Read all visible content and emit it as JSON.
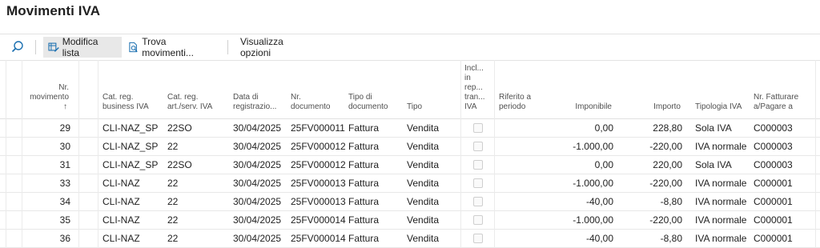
{
  "page": {
    "title": "Movimenti IVA"
  },
  "toolbar": {
    "search_icon": "search-icon",
    "edit_list_label": "Modifica lista",
    "find_entries_label": "Trova movimenti...",
    "view_options_label": "Visualizza opzioni"
  },
  "columns": {
    "nr_movimento": "Nr. movimento",
    "sort_indicator": "↑",
    "cat_business": "Cat. reg. business IVA",
    "cat_prodotto": "Cat. reg. art./serv. IVA",
    "data_reg": "Data di registrazio...",
    "nr_documento": "Nr. documento",
    "tipo_documento": "Tipo di documento",
    "tipo": "Tipo",
    "incl_trans": "Incl... in rep... tran... IVA",
    "riferito": "Riferito a periodo",
    "imponibile": "Imponibile",
    "importo": "Importo",
    "tipologia": "Tipologia IVA",
    "nr_fatturare": "Nr. Fatturare a/Pagare a"
  },
  "rows": [
    {
      "nr": "29",
      "cat_bus": "CLI-NAZ_SP",
      "cat_prod": "22SO",
      "data": "30/04/2025",
      "doc": "25FV000011",
      "tipo_doc": "Fattura",
      "tipo": "Vendita",
      "imponibile": "0,00",
      "importo": "228,80",
      "tipologia": "Sola IVA",
      "nr_fatt": "C000003"
    },
    {
      "nr": "30",
      "cat_bus": "CLI-NAZ_SP",
      "cat_prod": "22",
      "data": "30/04/2025",
      "doc": "25FV000012",
      "tipo_doc": "Fattura",
      "tipo": "Vendita",
      "imponibile": "-1.000,00",
      "importo": "-220,00",
      "tipologia": "IVA normale",
      "nr_fatt": "C000003"
    },
    {
      "nr": "31",
      "cat_bus": "CLI-NAZ_SP",
      "cat_prod": "22SO",
      "data": "30/04/2025",
      "doc": "25FV000012",
      "tipo_doc": "Fattura",
      "tipo": "Vendita",
      "imponibile": "0,00",
      "importo": "220,00",
      "tipologia": "Sola IVA",
      "nr_fatt": "C000003"
    },
    {
      "nr": "33",
      "cat_bus": "CLI-NAZ",
      "cat_prod": "22",
      "data": "30/04/2025",
      "doc": "25FV000013",
      "tipo_doc": "Fattura",
      "tipo": "Vendita",
      "imponibile": "-1.000,00",
      "importo": "-220,00",
      "tipologia": "IVA normale",
      "nr_fatt": "C000001"
    },
    {
      "nr": "34",
      "cat_bus": "CLI-NAZ",
      "cat_prod": "22",
      "data": "30/04/2025",
      "doc": "25FV000013",
      "tipo_doc": "Fattura",
      "tipo": "Vendita",
      "imponibile": "-40,00",
      "importo": "-8,80",
      "tipologia": "IVA normale",
      "nr_fatt": "C000001"
    },
    {
      "nr": "35",
      "cat_bus": "CLI-NAZ",
      "cat_prod": "22",
      "data": "30/04/2025",
      "doc": "25FV000014",
      "tipo_doc": "Fattura",
      "tipo": "Vendita",
      "imponibile": "-1.000,00",
      "importo": "-220,00",
      "tipologia": "IVA normale",
      "nr_fatt": "C000001"
    },
    {
      "nr": "36",
      "cat_bus": "CLI-NAZ",
      "cat_prod": "22",
      "data": "30/04/2025",
      "doc": "25FV000014",
      "tipo_doc": "Fattura",
      "tipo": "Vendita",
      "imponibile": "-40,00",
      "importo": "-8,80",
      "tipologia": "IVA normale",
      "nr_fatt": "C000001"
    }
  ]
}
